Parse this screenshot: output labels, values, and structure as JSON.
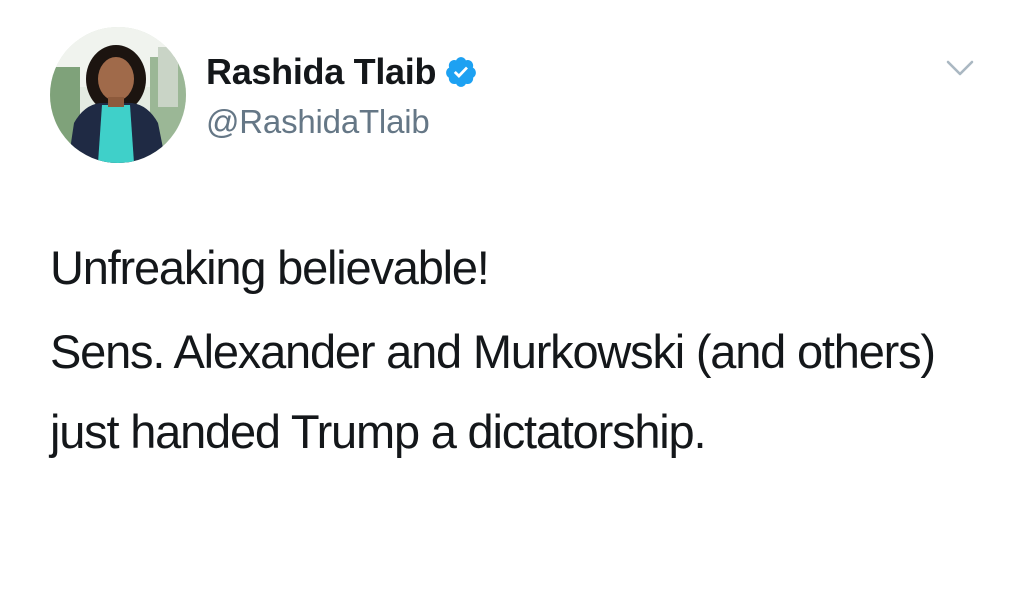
{
  "author": {
    "display_name": "Rashida Tlaib",
    "handle": "@RashidaTlaib",
    "verified": true
  },
  "tweet": {
    "paragraphs": [
      "Unfreaking believable!",
      "Sens. Alexander and Murkowski (and others) just handed Trump a dictatorship."
    ]
  },
  "icons": {
    "verified": "verified-badge-icon",
    "menu": "chevron-down-icon"
  },
  "colors": {
    "verified_blue": "#1da1f2",
    "handle_gray": "#657786",
    "text": "#14171a"
  }
}
